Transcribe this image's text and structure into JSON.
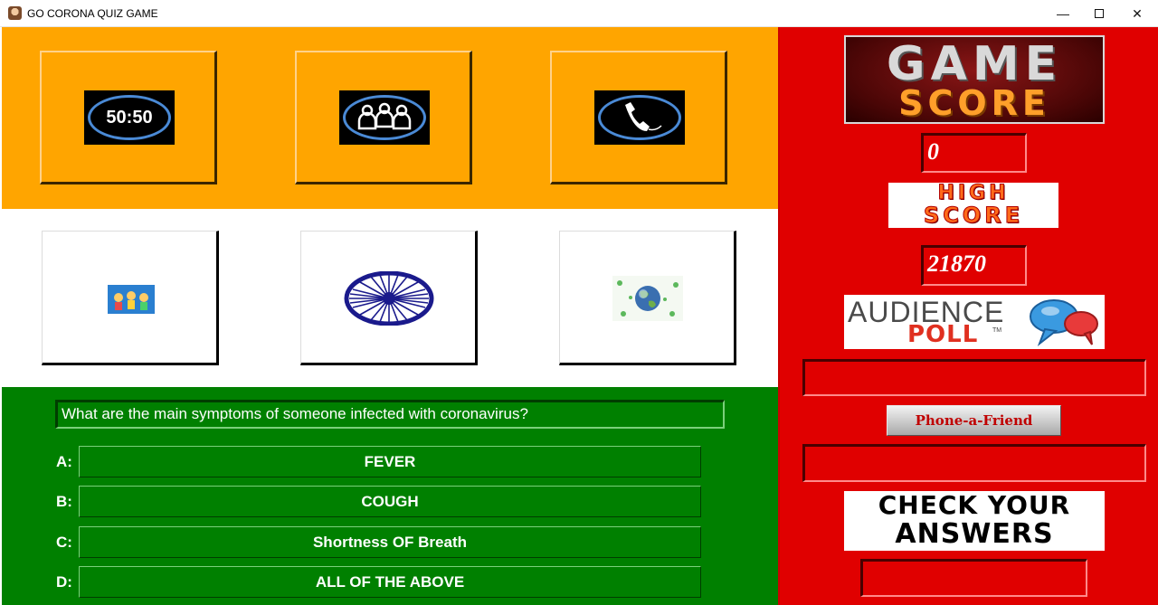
{
  "window": {
    "title": "GO CORONA QUIZ GAME",
    "controls": {
      "minimize": "—",
      "close": "✕"
    }
  },
  "lifelines": [
    {
      "name": "fifty-fifty",
      "label": "50:50",
      "icon": "fifty-fifty-icon"
    },
    {
      "name": "ask-audience",
      "icon": "audience-icon"
    },
    {
      "name": "phone-a-friend",
      "icon": "phone-icon"
    }
  ],
  "images": [
    {
      "name": "children-image",
      "icon": "children-icon"
    },
    {
      "name": "ashoka-chakra-image",
      "icon": "ashoka-chakra-icon"
    },
    {
      "name": "earth-virus-image",
      "icon": "earth-virus-icon"
    }
  ],
  "question": {
    "text": "What are the main symptoms of someone infected with coronavirus?"
  },
  "options": [
    {
      "letter": "A:",
      "text": "FEVER"
    },
    {
      "letter": "B:",
      "text": "COUGH"
    },
    {
      "letter": "C:",
      "text": "Shortness OF Breath"
    },
    {
      "letter": "D:",
      "text": "ALL OF THE ABOVE"
    }
  ],
  "panel": {
    "game_score_logo": {
      "line1": "GAME",
      "line2": "SCORE"
    },
    "score": "0",
    "high_score_logo": {
      "line1": "HIGH",
      "line2": "SCORE"
    },
    "high_score": "21870",
    "audience_poll_logo": {
      "line1": "AUDIENCE",
      "line2": "POLL",
      "tm": "TM"
    },
    "audience_poll_result": "",
    "phone_button": "Phone-a-Friend",
    "phone_result": "",
    "check_logo": {
      "line1": "CHECK YOUR",
      "line2": "ANSWERS"
    },
    "check_result": ""
  },
  "colors": {
    "saffron": "#ffa500",
    "white": "#ffffff",
    "green": "#008000",
    "panel_red": "#e00000",
    "ring_blue": "#4a8ad6",
    "chakra_navy": "#1a1a8c"
  }
}
